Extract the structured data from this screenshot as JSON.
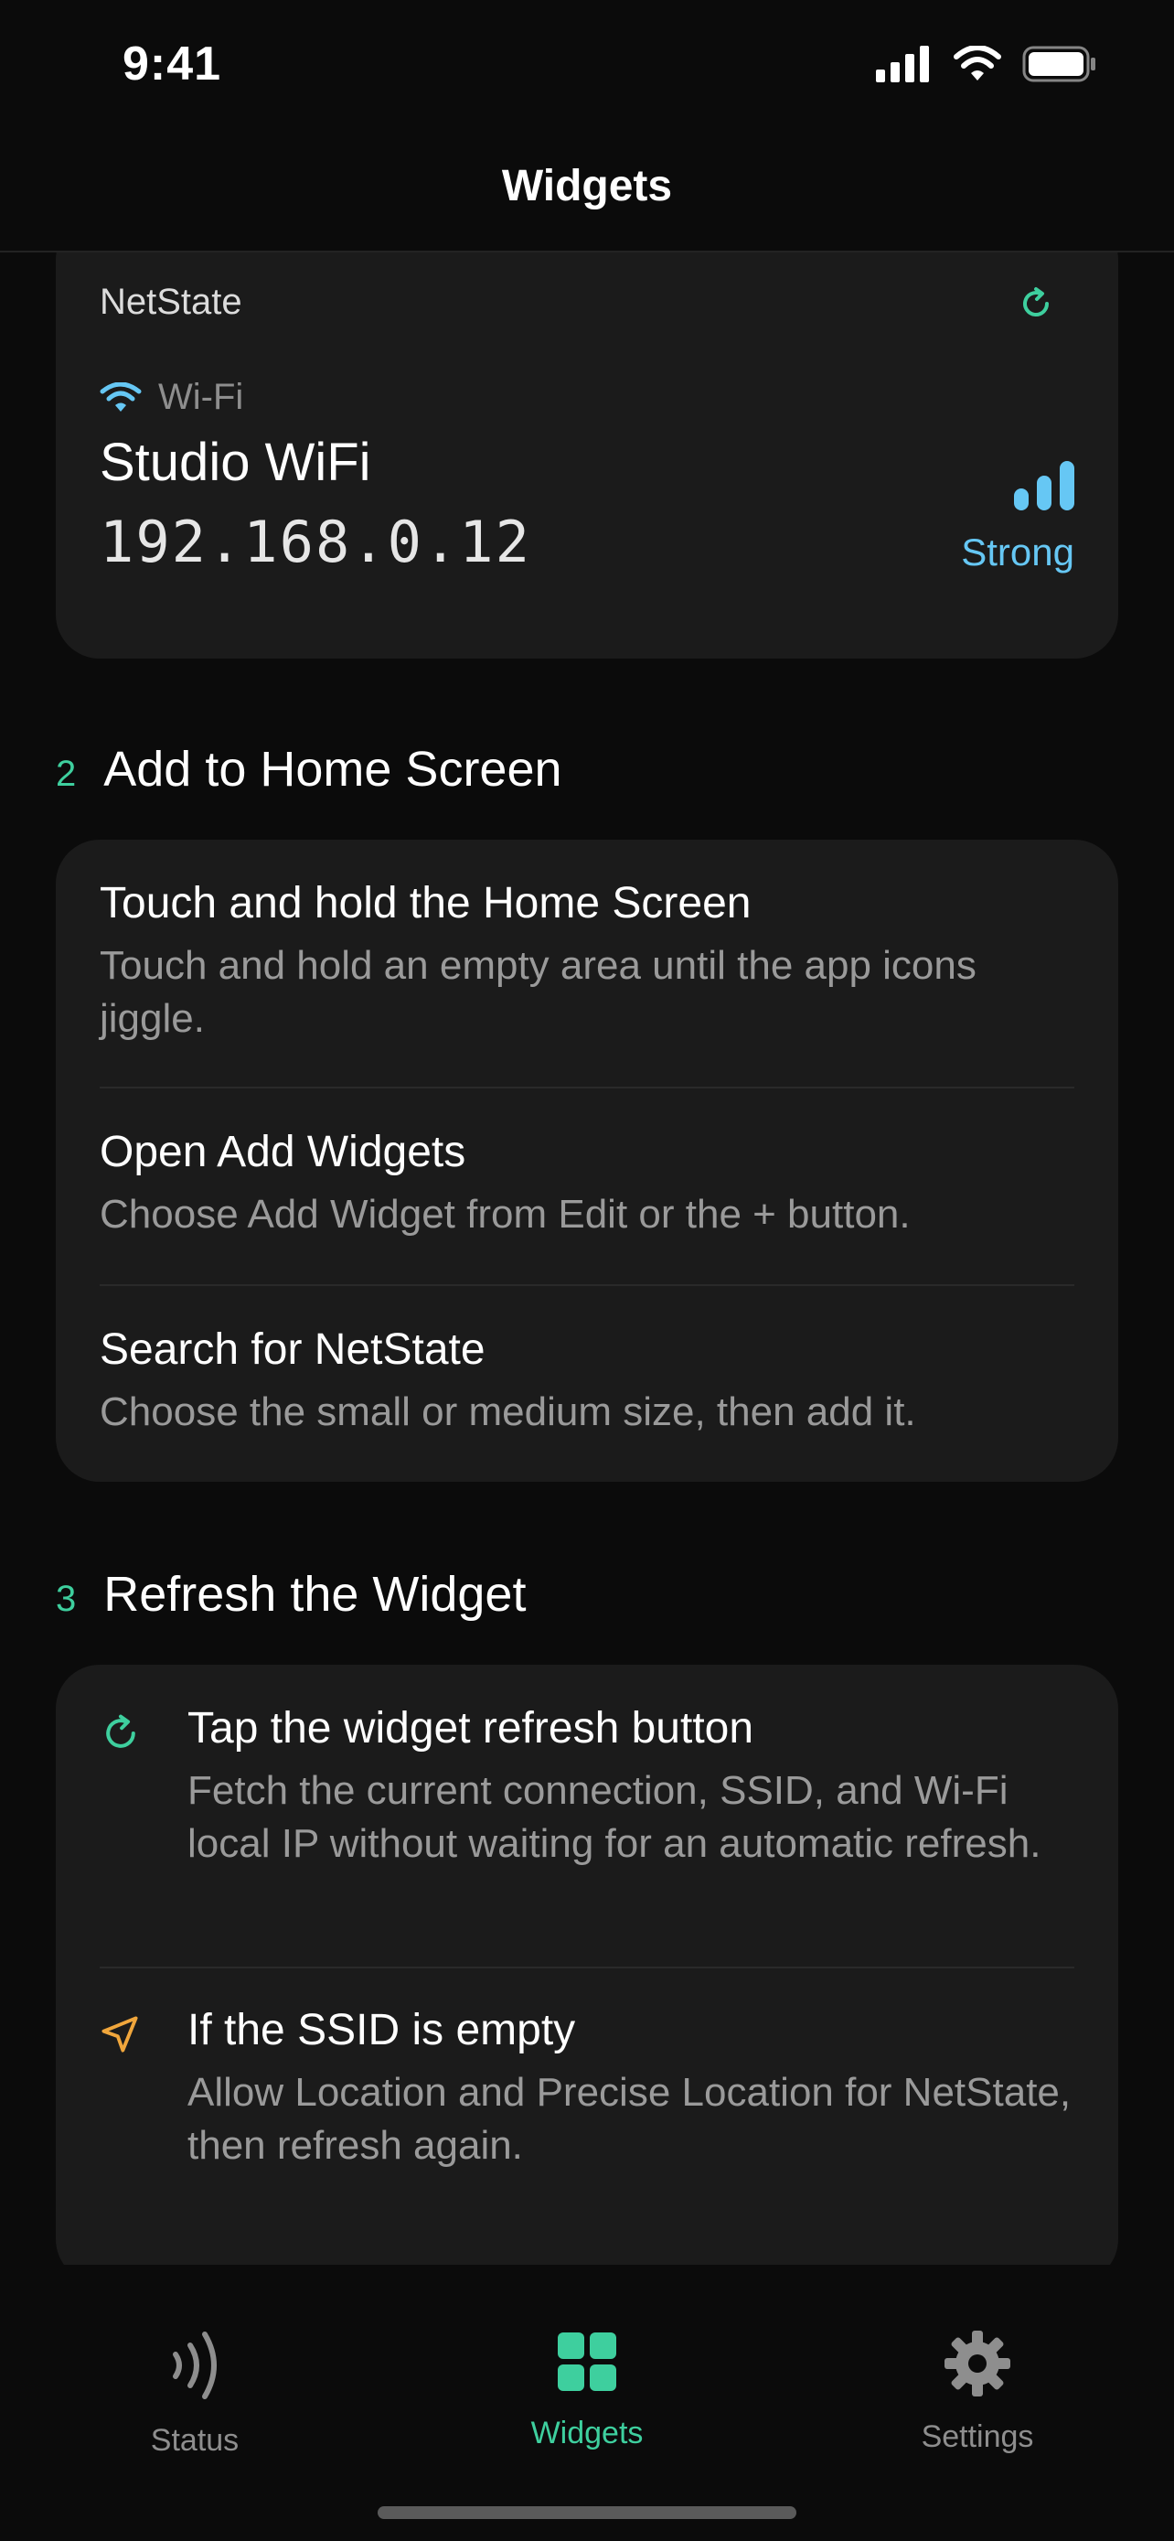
{
  "status_bar": {
    "time": "9:41"
  },
  "nav": {
    "title": "Widgets"
  },
  "preview": {
    "app_name": "NetState",
    "connection_type": "Wi-Fi",
    "ssid": "Studio WiFi",
    "ip": "192.168.0.12",
    "signal_label": "Strong"
  },
  "section2": {
    "number": "2",
    "title": "Add to Home Screen",
    "steps": [
      {
        "title": "Touch and hold the Home Screen",
        "desc": "Touch and hold an empty area until the app icons jiggle."
      },
      {
        "title": "Open Add Widgets",
        "desc": "Choose Add Widget from Edit or the + button."
      },
      {
        "title": "Search for NetState",
        "desc": "Choose the small or medium size, then add it."
      }
    ]
  },
  "section3": {
    "number": "3",
    "title": "Refresh the Widget",
    "steps": [
      {
        "icon": "refresh-icon",
        "title": "Tap the widget refresh button",
        "desc": "Fetch the current connection, SSID, and Wi-Fi local IP without waiting for an automatic refresh."
      },
      {
        "icon": "location-arrow-icon",
        "title": "If the SSID is empty",
        "desc": "Allow Location and Precise Location for NetState, then refresh again."
      }
    ]
  },
  "tabs": [
    {
      "label": "Status",
      "icon": "signal-waves-icon",
      "active": false
    },
    {
      "label": "Widgets",
      "icon": "grid-icon",
      "active": true
    },
    {
      "label": "Settings",
      "icon": "gear-icon",
      "active": false
    }
  ],
  "colors": {
    "accent_green": "#3ecf9e",
    "wifi_blue": "#66c7f4",
    "location_orange": "#f0a63c",
    "card_bg": "#1b1b1b",
    "background": "#0b0b0b"
  }
}
